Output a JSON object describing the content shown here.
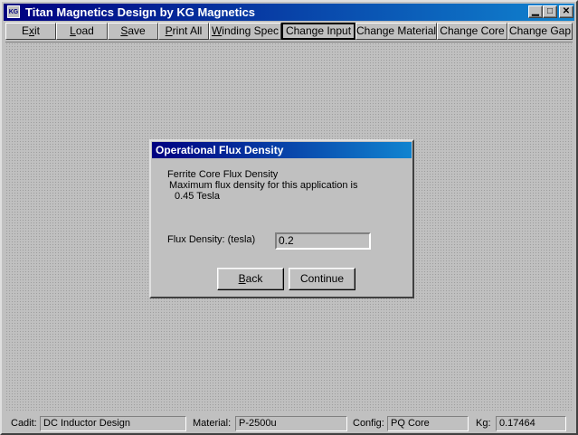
{
  "window": {
    "title": "Titan Magnetics Design by KG Magnetics",
    "icon_label": "KG",
    "controls": {
      "minimize": "▁",
      "maximize": "□",
      "close": "✕"
    }
  },
  "menu": {
    "items": [
      {
        "label": "Exit",
        "hotkey": "x"
      },
      {
        "label": "Load",
        "hotkey": "L"
      },
      {
        "label": "Save",
        "hotkey": "S"
      },
      {
        "label": "Print All",
        "hotkey": "P"
      },
      {
        "label": "Winding Spec",
        "hotkey": "W"
      },
      {
        "label": "Change Input"
      },
      {
        "label": "Change Material"
      },
      {
        "label": "Change Core"
      },
      {
        "label": "Change Gap"
      }
    ]
  },
  "dialog": {
    "title": "Operational Flux Density",
    "line1": "Ferrite Core Flux Density",
    "line2": "Maximum flux density for this application is",
    "line3": "0.45 Tesla",
    "field_label": "Flux Density: (tesla)",
    "field_value": "0.2",
    "back_label": "Back",
    "continue_label": "Continue"
  },
  "status": {
    "cadit_label": "Cadit:",
    "cadit_value": "DC Inductor Design",
    "material_label": "Material:",
    "material_value": "P-2500u",
    "config_label": "Config:",
    "config_value": "PQ Core",
    "kg_label": "Kg:",
    "kg_value": "0.17464"
  },
  "colors": {
    "titlebar": "#000080",
    "face": "#c0c0c0"
  }
}
